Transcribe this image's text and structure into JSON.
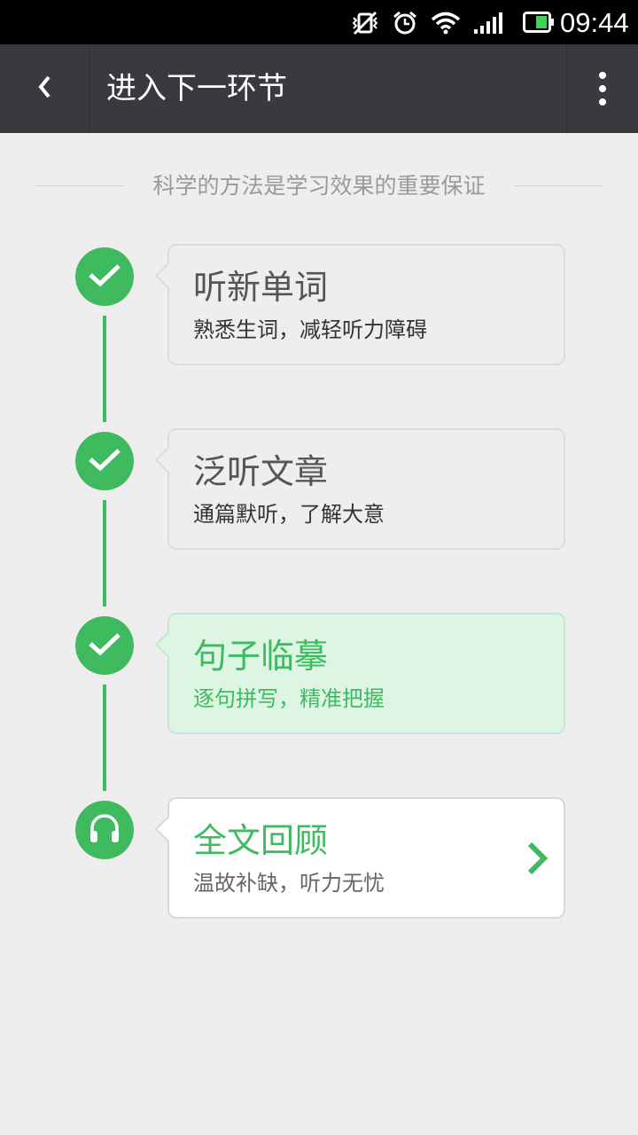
{
  "status_bar": {
    "time": "09:44"
  },
  "header": {
    "title": "进入下一环节"
  },
  "subtitle": "科学的方法是学习效果的重要保证",
  "steps": [
    {
      "title": "听新单词",
      "desc": "熟悉生词，减轻听力障碍",
      "state": "done",
      "icon": "check-icon"
    },
    {
      "title": "泛听文章",
      "desc": "通篇默听，了解大意",
      "state": "done",
      "icon": "check-icon"
    },
    {
      "title": "句子临摹",
      "desc": "逐句拼写，精准把握",
      "state": "current",
      "icon": "check-icon"
    },
    {
      "title": "全文回顾",
      "desc": "温故补缺，听力无忧",
      "state": "next",
      "icon": "headphones-icon"
    }
  ],
  "colors": {
    "accent": "#3fba5f",
    "header_bg": "#393a3f",
    "page_bg": "#eeeeee",
    "active_card_bg": "#dcf6e3"
  }
}
